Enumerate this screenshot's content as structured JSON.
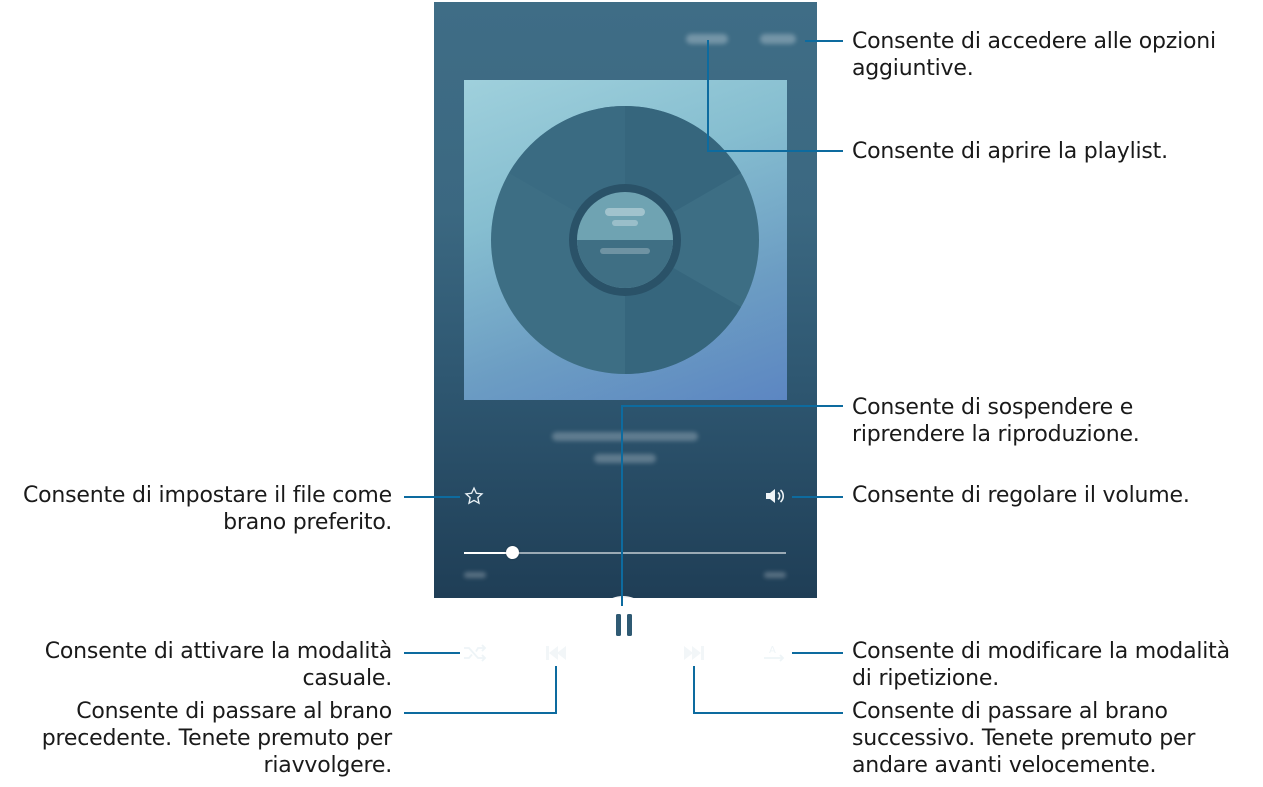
{
  "callouts": {
    "more_options": [
      "Consente di accedere alle opzioni",
      "aggiuntive."
    ],
    "playlist": [
      "Consente di aprire la playlist."
    ],
    "pause": [
      "Consente di sospendere e",
      "riprendere la riproduzione."
    ],
    "favorite": [
      "Consente di impostare il file come",
      "brano preferito."
    ],
    "volume": [
      "Consente di regolare il volume."
    ],
    "shuffle": [
      "Consente di attivare la modalità",
      "casuale."
    ],
    "repeat": [
      "Consente di modificare la modalità",
      "di ripetizione."
    ],
    "previous": [
      "Consente di passare al brano",
      "precedente. Tenete premuto per",
      "riavvolgere."
    ],
    "next": [
      "Consente di passare al brano",
      "successivo. Tenete premuto per",
      "andare avanti velocemente."
    ]
  },
  "player": {
    "progress_fraction": 0.15,
    "icons": {
      "favorite": "star-outline-icon",
      "volume": "speaker-icon",
      "shuffle": "shuffle-icon",
      "previous": "skip-previous-icon",
      "pause": "pause-icon",
      "next": "skip-next-icon",
      "repeat": "repeat-icon"
    }
  },
  "colors": {
    "callout_line": "#0d6b9f",
    "screen_bg": "#3b6881",
    "art_bg": "#86bed0"
  }
}
